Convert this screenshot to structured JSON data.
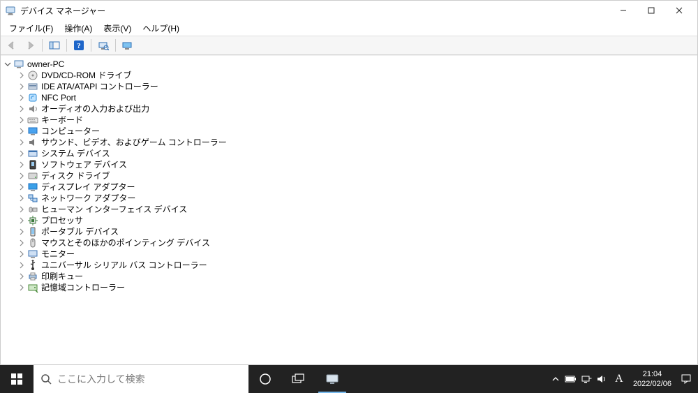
{
  "window": {
    "title": "デバイス マネージャー"
  },
  "menubar": {
    "file": "ファイル(F)",
    "action": "操作(A)",
    "view": "表示(V)",
    "help": "ヘルプ(H)"
  },
  "tree": {
    "root": "owner-PC",
    "items": [
      {
        "icon": "optical",
        "label": "DVD/CD-ROM ドライブ"
      },
      {
        "icon": "ide",
        "label": "IDE ATA/ATAPI コントローラー"
      },
      {
        "icon": "nfc",
        "label": "NFC Port"
      },
      {
        "icon": "audio",
        "label": "オーディオの入力および出力"
      },
      {
        "icon": "keyboard",
        "label": "キーボード"
      },
      {
        "icon": "computer",
        "label": "コンピューター"
      },
      {
        "icon": "sound",
        "label": "サウンド、ビデオ、およびゲーム コントローラー"
      },
      {
        "icon": "system",
        "label": "システム デバイス"
      },
      {
        "icon": "software",
        "label": "ソフトウェア デバイス"
      },
      {
        "icon": "disk",
        "label": "ディスク ドライブ"
      },
      {
        "icon": "display",
        "label": "ディスプレイ アダプター"
      },
      {
        "icon": "network",
        "label": "ネットワーク アダプター"
      },
      {
        "icon": "hid",
        "label": "ヒューマン インターフェイス デバイス"
      },
      {
        "icon": "cpu",
        "label": "プロセッサ"
      },
      {
        "icon": "portable",
        "label": "ポータブル デバイス"
      },
      {
        "icon": "mouse",
        "label": "マウスとそのほかのポインティング デバイス"
      },
      {
        "icon": "monitor",
        "label": "モニター"
      },
      {
        "icon": "usb",
        "label": "ユニバーサル シリアル バス コントローラー"
      },
      {
        "icon": "print",
        "label": "印刷キュー"
      },
      {
        "icon": "storage",
        "label": "記憶域コントローラー"
      }
    ]
  },
  "taskbar": {
    "search_placeholder": "ここに入力して検索",
    "ime": "A",
    "time": "21:04",
    "date": "2022/02/06"
  }
}
